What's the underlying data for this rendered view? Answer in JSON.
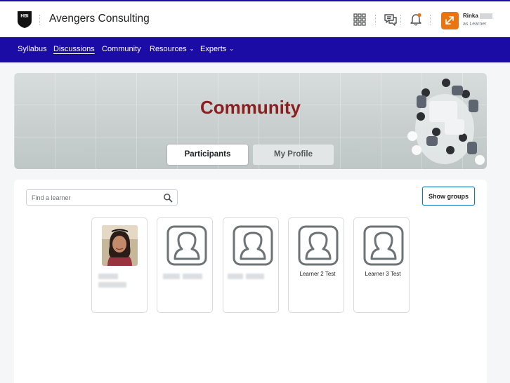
{
  "header": {
    "logo_text": "HBI",
    "org_title": "Avengers Consulting",
    "user": {
      "name": "Rinka",
      "role": "as Learner"
    },
    "icons": [
      "waffle-icon",
      "chat-icon",
      "bell-icon"
    ],
    "notification_dot_color": "#e87511"
  },
  "nav": {
    "items": [
      {
        "label": "Syllabus",
        "active": false,
        "dropdown": false
      },
      {
        "label": "Discussions",
        "active": true,
        "dropdown": false
      },
      {
        "label": "Community",
        "active": false,
        "dropdown": false
      },
      {
        "label": "Resources",
        "active": false,
        "dropdown": true
      },
      {
        "label": "Experts",
        "active": false,
        "dropdown": true
      }
    ],
    "color": "#1c0ca6"
  },
  "banner": {
    "title": "Community",
    "tabs": [
      {
        "label": "Participants",
        "selected": true
      },
      {
        "label": "My Profile",
        "selected": false
      }
    ]
  },
  "panel": {
    "search_placeholder": "Find a learner",
    "show_groups_label": "Show groups",
    "cards": [
      {
        "name": "",
        "type": "photo"
      },
      {
        "name": "",
        "type": "placeholder"
      },
      {
        "name": "",
        "type": "placeholder"
      },
      {
        "name": "Learner 2 Test",
        "type": "placeholder"
      },
      {
        "name": "Learner 3 Test",
        "type": "placeholder"
      }
    ]
  },
  "colors": {
    "accent": "#1c0ca6",
    "title": "#8b1f1f",
    "badge": "#e87511"
  }
}
